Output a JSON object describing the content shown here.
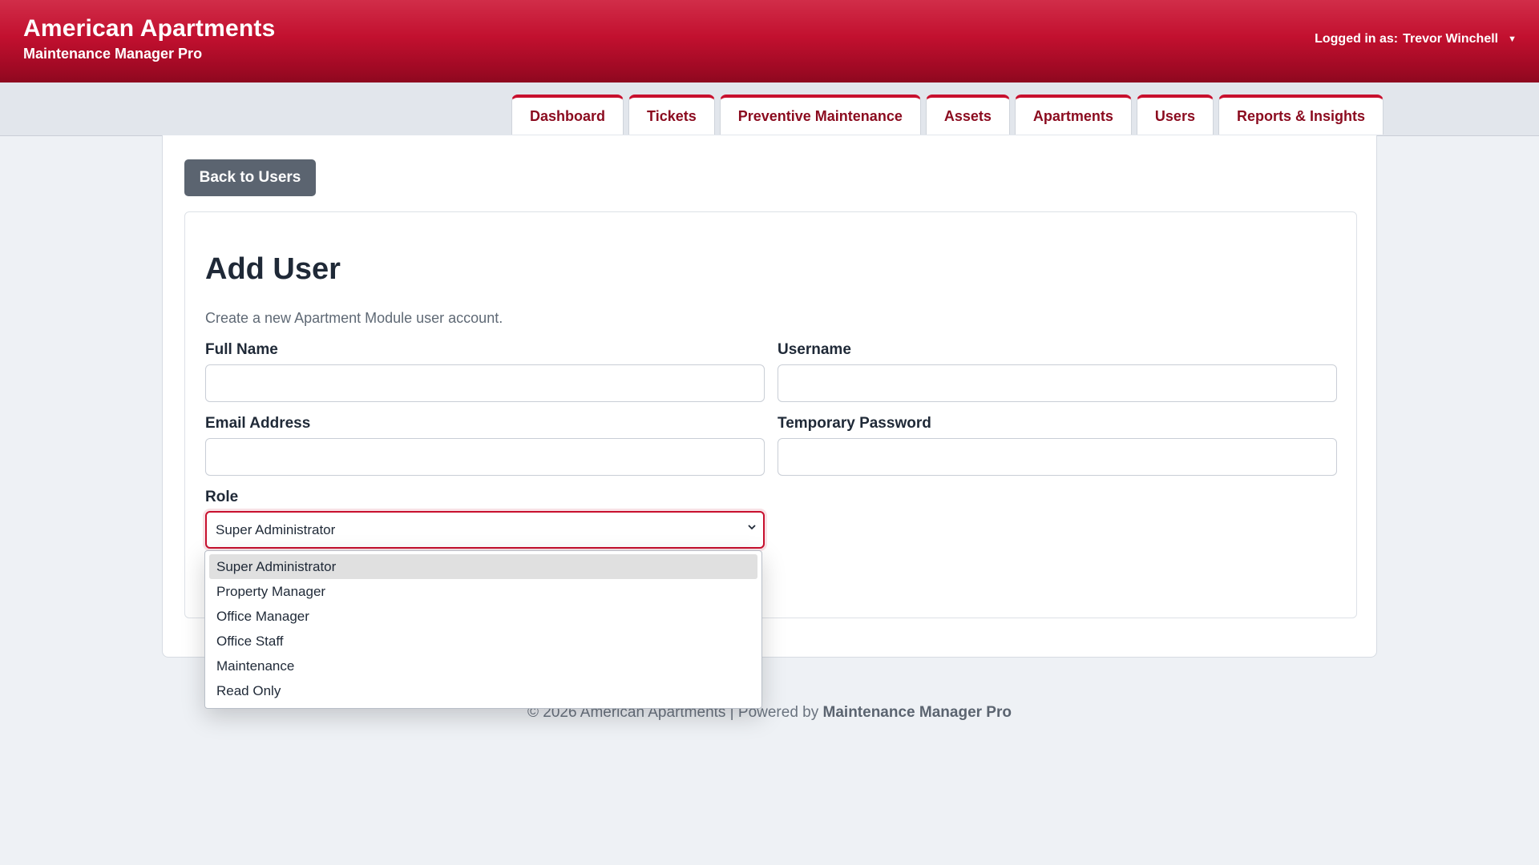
{
  "header": {
    "brand_title": "American Apartments",
    "brand_subtitle": "Maintenance Manager Pro",
    "user_prefix": "Logged in as:",
    "user_name": "Trevor Winchell",
    "user_caret": "▼"
  },
  "nav": {
    "tabs": [
      "Dashboard",
      "Tickets",
      "Preventive Maintenance",
      "Assets",
      "Apartments",
      "Users",
      "Reports & Insights"
    ]
  },
  "page": {
    "back_label": "Back to Users",
    "title": "Add User",
    "description": "Create a new Apartment Module user account.",
    "fields": {
      "full_name_label": "Full Name",
      "full_name_value": "",
      "username_label": "Username",
      "username_value": "",
      "email_label": "Email Address",
      "email_value": "",
      "password_label": "Temporary Password",
      "password_value": "",
      "role_label": "Role",
      "role_value": "Super Administrator"
    },
    "role_options": [
      "Super Administrator",
      "Property Manager",
      "Office Manager",
      "Office Staff",
      "Maintenance",
      "Read Only"
    ]
  },
  "footer": {
    "text": "© 2026 American Apartments | Powered by",
    "brand": "Maintenance Manager Pro"
  },
  "colors": {
    "brand_red": "#c8102e",
    "tab_text": "#8b0b1f",
    "back_button": "#5b6470",
    "page_bg": "#eef1f5"
  }
}
